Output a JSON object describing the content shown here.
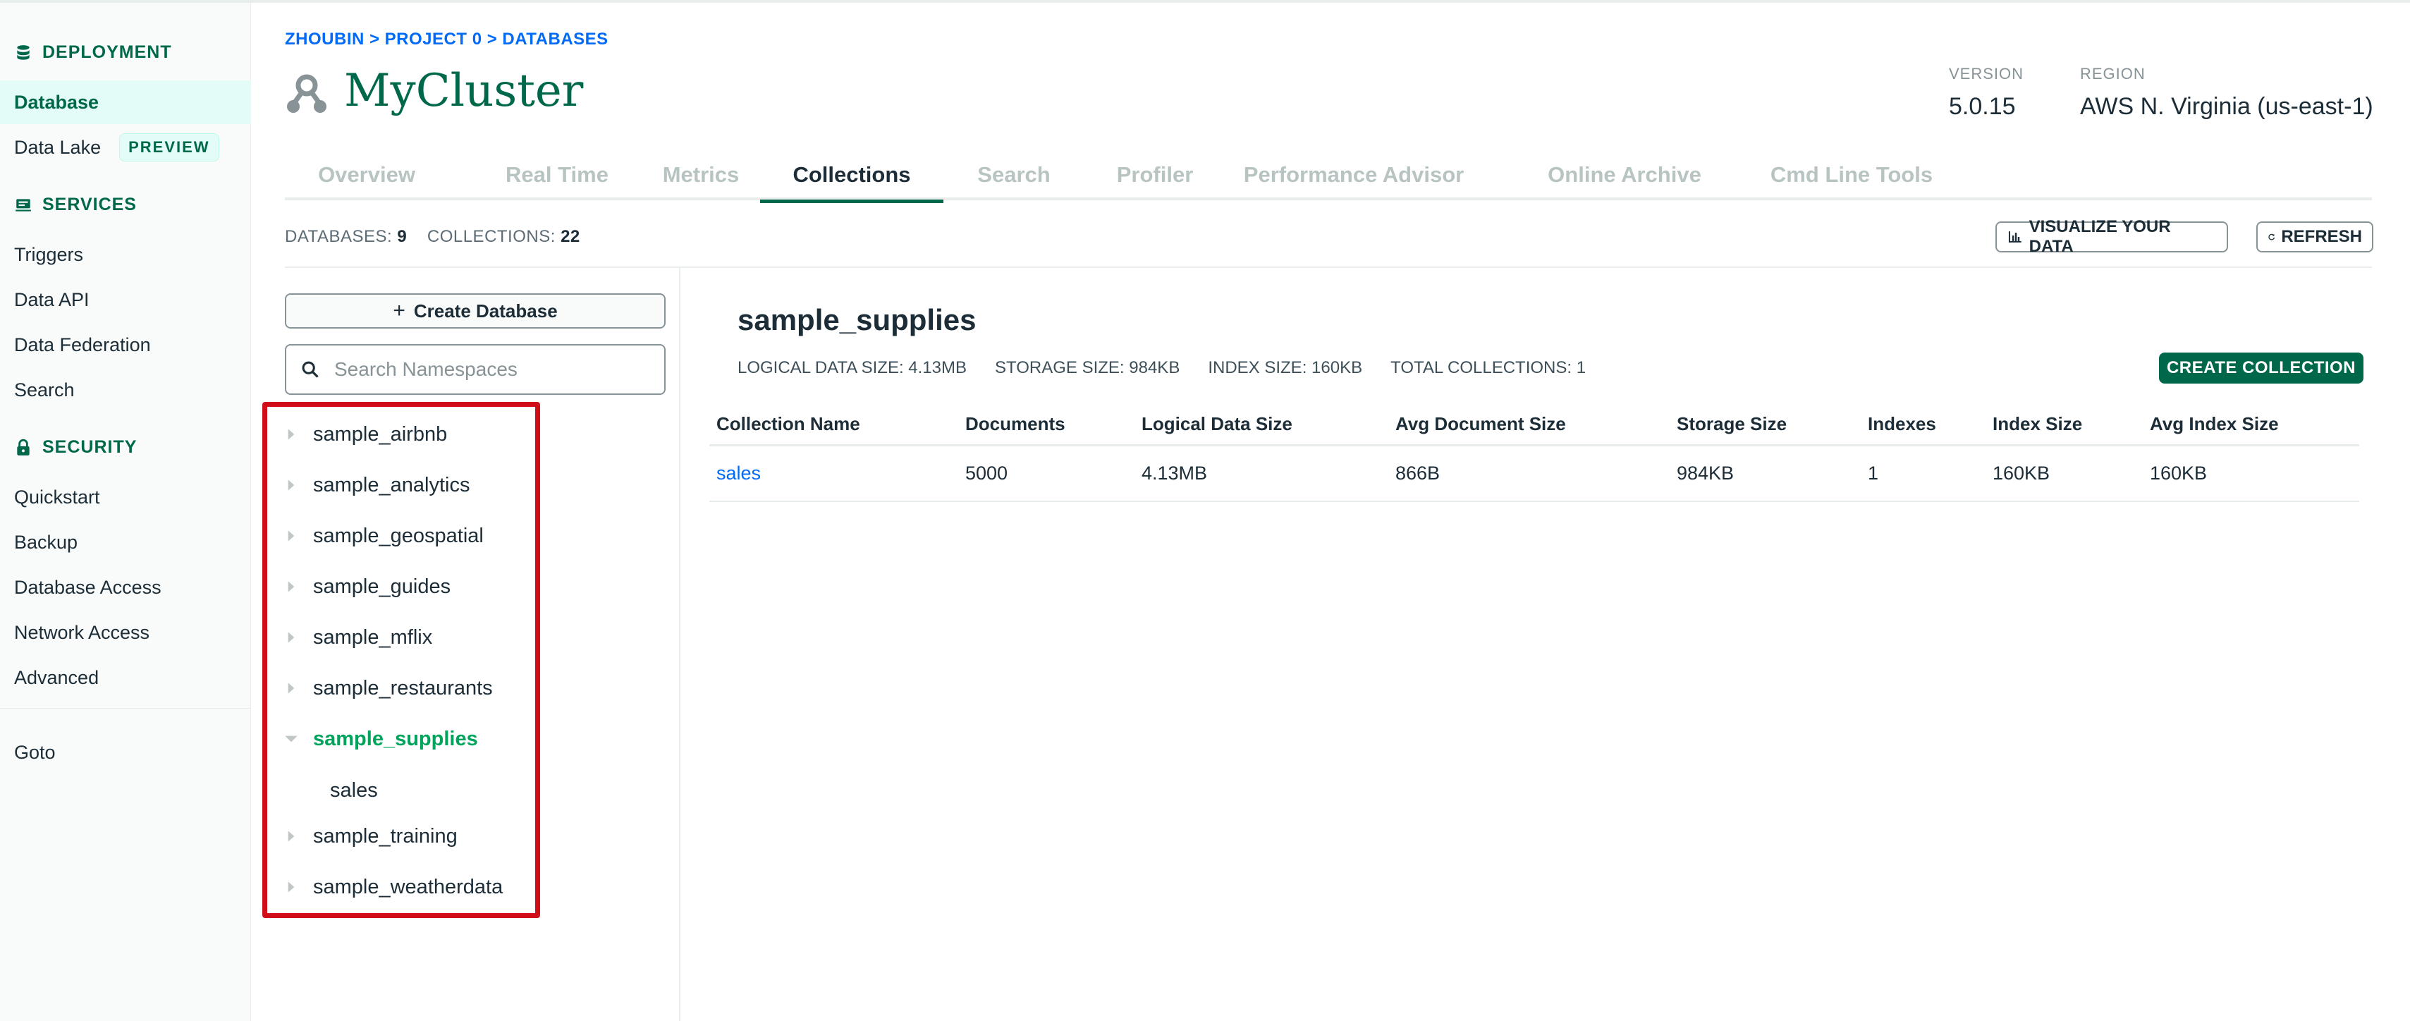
{
  "sidebar": {
    "deployment_head": "DEPLOYMENT",
    "items_deploy": [
      {
        "label": "Database"
      },
      {
        "label": "Data Lake",
        "badge": "PREVIEW"
      }
    ],
    "services_head": "SERVICES",
    "items_services": [
      {
        "label": "Triggers"
      },
      {
        "label": "Data API"
      },
      {
        "label": "Data Federation"
      },
      {
        "label": "Search"
      }
    ],
    "security_head": "SECURITY",
    "items_security": [
      {
        "label": "Quickstart"
      },
      {
        "label": "Backup"
      },
      {
        "label": "Database Access"
      },
      {
        "label": "Network Access"
      },
      {
        "label": "Advanced"
      }
    ],
    "goto": "Goto"
  },
  "header": {
    "breadcrumb": "ZHOUBIN > PROJECT 0 > DATABASES",
    "title": "MyCluster",
    "version_label": "VERSION",
    "version_value": "5.0.15",
    "region_label": "REGION",
    "region_value": "AWS N. Virginia (us-east-1)"
  },
  "tabs": [
    "Overview",
    "Real Time",
    "Metrics",
    "Collections",
    "Search",
    "Profiler",
    "Performance Advisor",
    "Online Archive",
    "Cmd Line Tools"
  ],
  "active_tab": "Collections",
  "counts": {
    "databases_label": "DATABASES:",
    "databases_value": "9",
    "collections_label": "COLLECTIONS:",
    "collections_value": "22"
  },
  "actions": {
    "visualize": "VISUALIZE YOUR DATA",
    "refresh": "REFRESH"
  },
  "left_panel": {
    "create_db": "Create Database",
    "search_placeholder": "Search Namespaces",
    "databases": [
      {
        "name": "sample_airbnb",
        "open": false
      },
      {
        "name": "sample_analytics",
        "open": false
      },
      {
        "name": "sample_geospatial",
        "open": false
      },
      {
        "name": "sample_guides",
        "open": false
      },
      {
        "name": "sample_mflix",
        "open": false
      },
      {
        "name": "sample_restaurants",
        "open": false
      },
      {
        "name": "sample_supplies",
        "open": true,
        "collections": [
          "sales"
        ]
      },
      {
        "name": "sample_training",
        "open": false
      },
      {
        "name": "sample_weatherdata",
        "open": false
      }
    ]
  },
  "detail": {
    "db_name": "sample_supplies",
    "logical_size": "LOGICAL DATA SIZE: 4.13MB",
    "storage_size": "STORAGE SIZE: 984KB",
    "index_size": "INDEX SIZE: 160KB",
    "total_collections": "TOTAL COLLECTIONS: 1",
    "create_collection": "CREATE COLLECTION",
    "columns": [
      "Collection Name",
      "Documents",
      "Logical Data Size",
      "Avg Document Size",
      "Storage Size",
      "Indexes",
      "Index Size",
      "Avg Index Size"
    ],
    "rows": [
      [
        "sales",
        "5000",
        "4.13MB",
        "866B",
        "984KB",
        "1",
        "160KB",
        "160KB"
      ]
    ]
  },
  "colors": {
    "brand_green": "#00684a",
    "active_db_green": "#00a35c",
    "link_blue": "#016bf8",
    "highlight_red": "#d10d19"
  }
}
